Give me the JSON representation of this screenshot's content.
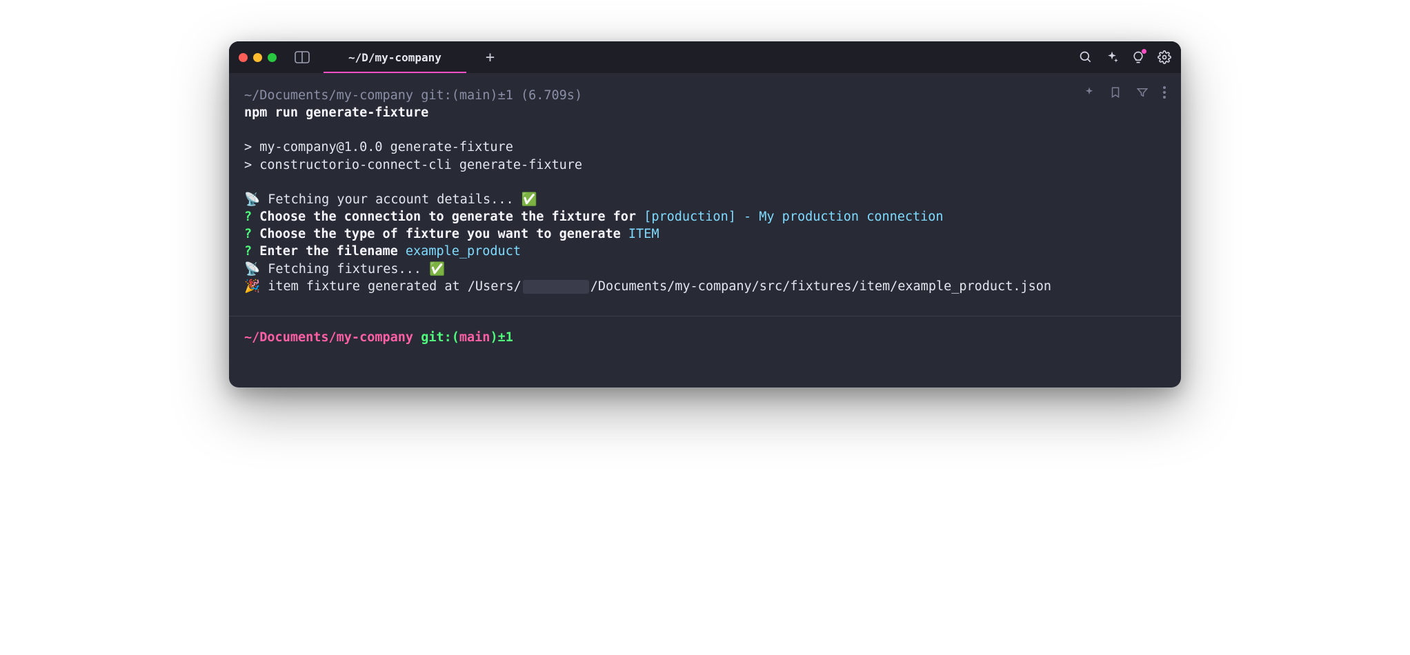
{
  "tab": {
    "title": "~/D/my-company"
  },
  "prompt1": {
    "path": "~/Documents/my-company",
    "git": "git:(main)±1",
    "time": "(6.709s)"
  },
  "cmd": "npm run generate-fixture",
  "out": {
    "l1": "> my-company@1.0.0 generate-fixture",
    "l2": "> constructorio-connect-cli generate-fixture",
    "fetch1_pre": "📡 ",
    "fetch1": "Fetching your account details...",
    "check": " ✅",
    "q1_mark": "?",
    "q1": " Choose the connection to generate the fixture for ",
    "q1_ans": "[production] - My production connection",
    "q2": " Choose the type of fixture you want to generate ",
    "q2_ans": "ITEM",
    "q3": " Enter the filename ",
    "q3_ans": "example_product",
    "fetch2_pre": "📡 ",
    "fetch2": "Fetching fixtures...",
    "done_pre": "🎉 ",
    "done_a": "item fixture generated at /Users/",
    "done_b": "/Documents/my-company/src/fixtures/item/example_product.json"
  },
  "prompt2": {
    "path": "~/Documents/my-company",
    "git_label": "git:",
    "paren_open": "(",
    "branch": "main",
    "paren_close": ")",
    "dirty": "±1"
  }
}
